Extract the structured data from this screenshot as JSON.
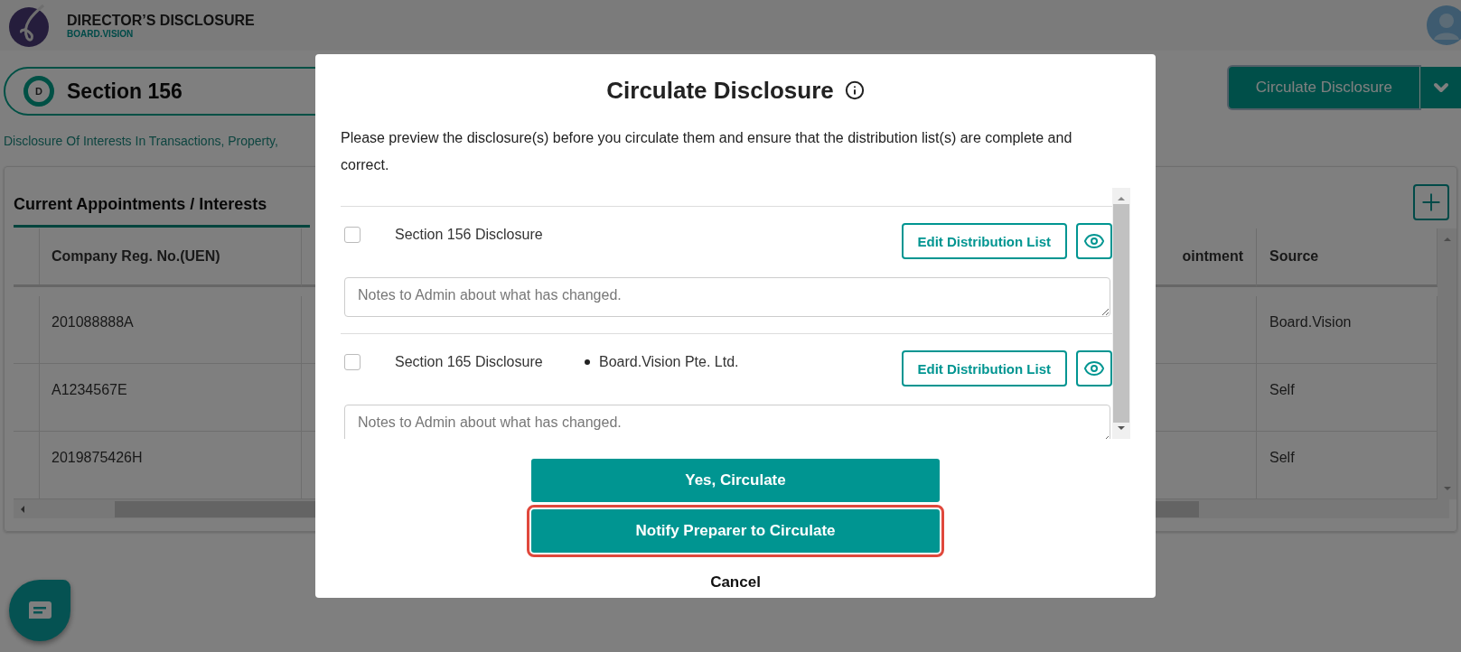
{
  "app": {
    "title": "DIRECTOR’S DISCLOSURE",
    "subtitle": "BOARD.VISION"
  },
  "section": {
    "badge": "D",
    "title": "Section 156",
    "description": "Disclosure Of Interests In Transactions, Property,"
  },
  "actions": {
    "primary": "Circulate Disclosure"
  },
  "card": {
    "tab": "Current Appointments / Interests",
    "columns": {
      "uen": "Company Reg. No.(UEN)",
      "column_2": "ointment",
      "source": "Source"
    },
    "rows": [
      {
        "uen": "201088888A",
        "source": "Board.Vision"
      },
      {
        "uen": "A1234567E",
        "source": "Self"
      },
      {
        "uen": "2019875426H",
        "source": "Self"
      }
    ]
  },
  "modal": {
    "title": "Circulate Disclosure",
    "intro": "Please preview the disclosure(s) before you circulate them and ensure that the distribution list(s) are complete and correct.",
    "items": [
      {
        "label": "Section 156 Disclosure",
        "checked": false,
        "action": "Edit Distribution List",
        "notes_placeholder": "Notes to Admin about what has changed."
      },
      {
        "label": "Section 165 Disclosure",
        "checked": false,
        "entities": [
          "Board.Vision Pte. Ltd."
        ],
        "action": "Edit Distribution List",
        "notes_placeholder": "Notes to Admin about what has changed."
      }
    ],
    "buttons": [
      {
        "label": "Yes, Circulate",
        "highlighted": false
      },
      {
        "label": "Notify Preparer to Circulate",
        "highlighted": true
      }
    ],
    "cancel": "Cancel"
  }
}
